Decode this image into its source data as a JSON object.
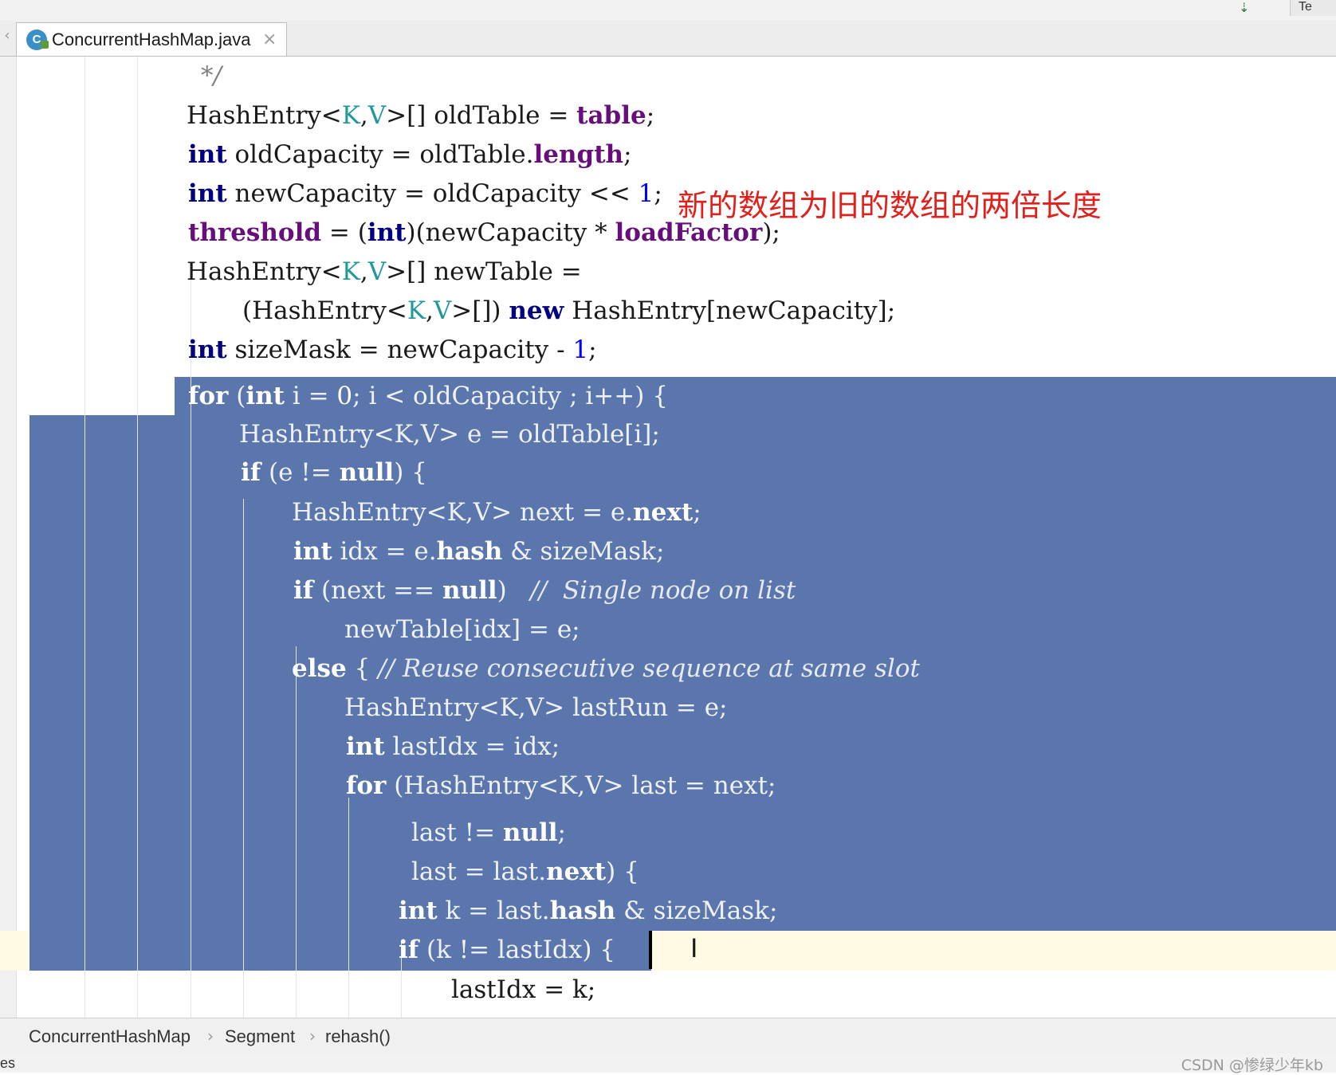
{
  "top_toolbar": {
    "vcs_icon": "⇣",
    "right_button": "Te"
  },
  "tab": {
    "icon_letter": "C",
    "title": "ConcurrentHashMap.java",
    "close": "×",
    "scroll_left": "‹"
  },
  "annotation": "新的数组为旧的数组的两倍长度",
  "code": {
    "l0_comment": "*/",
    "l1": {
      "a": "HashEntry<",
      "b": "K",
      "c": ",",
      "d": "V",
      "e": ">[] oldTable = ",
      "f": "table",
      "g": ";"
    },
    "l2": {
      "a": "int",
      "b": " oldCapacity = oldTable.",
      "c": "length",
      "d": ";"
    },
    "l3": {
      "a": "int",
      "b": " newCapacity = oldCapacity << ",
      "c": "1",
      "d": ";"
    },
    "l4": {
      "a": "threshold",
      "b": " = (",
      "c": "int",
      "d": ")(newCapacity * ",
      "e": "loadFactor",
      "f": ");"
    },
    "l5": {
      "a": "HashEntry<",
      "b": "K",
      "c": ",",
      "d": "V",
      "e": ">[] newTable ="
    },
    "l6": {
      "a": "(HashEntry<",
      "b": "K",
      "c": ",",
      "d": "V",
      "e": ">[]) ",
      "f": "new",
      "g": " HashEntry[newCapacity];"
    },
    "l7": {
      "a": "int",
      "b": " sizeMask = newCapacity - ",
      "c": "1",
      "d": ";"
    },
    "l8": {
      "a": "for",
      "b": " (",
      "c": "int",
      "d": " i = ",
      "e": "0",
      "f": "; i < oldCapacity ; i++) {"
    },
    "l9": {
      "a": "HashEntry<K,V> e = oldTable[i];"
    },
    "l10": {
      "a": "if",
      "b": " (e != ",
      "c": "null",
      "d": ") {"
    },
    "l11": {
      "a": "HashEntry<K,V> next = e.",
      "b": "next",
      "c": ";"
    },
    "l12": {
      "a": "int",
      "b": " idx = e.",
      "c": "hash",
      "d": " & sizeMask;"
    },
    "l13": {
      "a": "if",
      "b": " (next == ",
      "c": "null",
      "d": ")   ",
      "e": "//  Single node on list"
    },
    "l14": {
      "a": "newTable[idx] = e;"
    },
    "l15": {
      "a": "else",
      "b": " { ",
      "c": "// Reuse consecutive sequence at same slot"
    },
    "l16": {
      "a": "HashEntry<K,V> lastRun = e;"
    },
    "l17": {
      "a": "int",
      "b": " lastIdx = idx;"
    },
    "l18": {
      "a": "for",
      "b": " (HashEntry<K,V> last = next;"
    },
    "l19": {
      "a": "last != ",
      "b": "null",
      "c": ";"
    },
    "l20": {
      "a": "last = last.",
      "b": "next",
      "c": ") {"
    },
    "l21": {
      "a": "int",
      "b": " k = last.",
      "c": "hash",
      "d": " & sizeMask;"
    },
    "l22": {
      "a": "if",
      "b": " (k != lastIdx) {"
    },
    "l23": {
      "a": "lastIdx = k;"
    }
  },
  "breadcrumb": {
    "items": [
      "ConcurrentHashMap",
      "Segment",
      "rehash()"
    ],
    "separator": "›"
  },
  "status": {
    "left": "es",
    "watermark": "CSDN @惨绿少年kb"
  },
  "colors": {
    "selection": "#5a76ac",
    "keyword": "#000080",
    "field": "#660e7a",
    "generic": "#20999d",
    "number": "#0000ff",
    "comment": "#808080",
    "annotation": "#e0201b"
  }
}
